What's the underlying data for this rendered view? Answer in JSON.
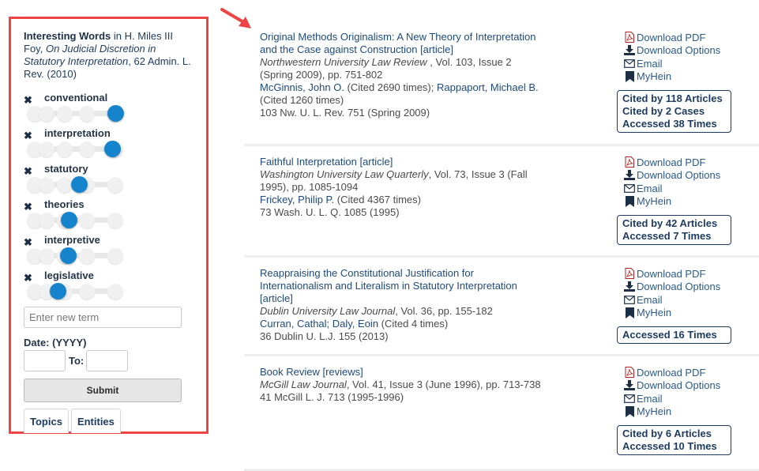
{
  "sidebar": {
    "heading_bold": "Interesting Words",
    "heading_in": " in H. Miles III Foy,",
    "heading_title": "On Judicial Discretion in Statutory Interpretation",
    "heading_cite": ", 62 Admin. L. Rev. (2010)",
    "terms": [
      {
        "label": "conventional",
        "value": 1.0
      },
      {
        "label": "interpretation",
        "value": 0.96
      },
      {
        "label": "statutory",
        "value": 0.55
      },
      {
        "label": "theories",
        "value": 0.42
      },
      {
        "label": "interpretive",
        "value": 0.41
      },
      {
        "label": "legislative",
        "value": 0.28
      }
    ],
    "remove_icon": "✖",
    "new_term_placeholder": "Enter new term",
    "date_label": "Date: (YYYY)",
    "date_from": "",
    "date_to": "",
    "to_label": "To:",
    "submit_label": "Submit",
    "tabs": [
      "Topics",
      "Entities"
    ]
  },
  "colors": {
    "accent": "#1684cc",
    "link": "#1d4a7c",
    "sidebar_border": "#ef4444",
    "pdf_icon": "#b22222"
  },
  "actions": {
    "pdf": "Download PDF",
    "options": "Download Options",
    "email": "Email",
    "myhein": "MyHein"
  },
  "results": [
    {
      "title": "Original Methods Originalism: A New Theory of Interpretation and the Case against Construction [article]",
      "journal": "Northwestern University Law Review",
      "details": " , Vol. 103, Issue 2 (Spring 2009), pp. 751-802",
      "authors": [
        {
          "name": "McGinnis, John O.",
          "cited": " (Cited 2690 times); "
        },
        {
          "name": "Rappaport, Michael B.",
          "cited": " (Cited 1260 times)"
        }
      ],
      "citation": "103 Nw. U. L. Rev. 751 (Spring 2009)",
      "stats": [
        "Cited by 118 Articles",
        "Cited by 2 Cases",
        "Accessed 38 Times"
      ]
    },
    {
      "title": "Faithful Interpretation [article]",
      "journal": "Washington University Law Quarterly",
      "details": ", Vol. 73, Issue 3 (Fall 1995), pp. 1085-1094",
      "authors": [
        {
          "name": "Frickey, Philip P.",
          "cited": " (Cited 4367 times)"
        }
      ],
      "citation": "73 Wash. U. L. Q. 1085 (1995)",
      "stats": [
        "Cited by 42 Articles",
        "Accessed 7 Times"
      ]
    },
    {
      "title": "Reappraising the Constitutional Justification for Internationalism and Literalism in Statutory Interpretation [article]",
      "journal": "Dublin University Law Journal",
      "details": ", Vol. 36, pp. 155-182",
      "authors": [
        {
          "name": "Curran, Cathal; Daly, Eoin",
          "cited": " (Cited 4 times)"
        }
      ],
      "citation": "36 Dublin U. L.J. 155 (2013)",
      "stats": [
        "Accessed 16 Times"
      ]
    },
    {
      "title": "Book Review [reviews]",
      "journal": "McGill Law Journal",
      "details": ", Vol. 41, Issue 3 (June 1996), pp. 713-738",
      "authors": [],
      "citation": "41 McGill L. J. 713 (1995-1996)",
      "stats": [
        "Cited by 6 Articles",
        "Accessed 10 Times"
      ]
    }
  ]
}
